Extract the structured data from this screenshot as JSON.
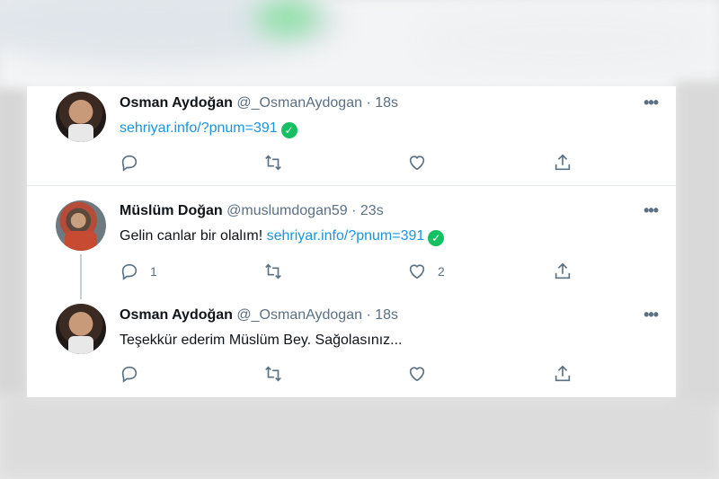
{
  "tweets": [
    {
      "name": "Osman Aydoğan",
      "handle": "@_OsmanAydogan",
      "sep": "·",
      "time": "18s",
      "text": "",
      "link": "sehriyar.info/?pnum=391",
      "verified_link": true,
      "reply_count": "",
      "like_count": ""
    },
    {
      "name": "Müslüm Doğan",
      "handle": "@muslumdogan59",
      "sep": "·",
      "time": "23s",
      "text": "Gelin canlar bir olalım!",
      "link": "sehriyar.info/?pnum=391",
      "verified_link": true,
      "reply_count": "1",
      "like_count": "2"
    },
    {
      "name": "Osman Aydoğan",
      "handle": "@_OsmanAydogan",
      "sep": "·",
      "time": "18s",
      "text": "Teşekkür ederim Müslüm Bey. Sağolasınız...",
      "link": "",
      "verified_link": false,
      "reply_count": "",
      "like_count": ""
    }
  ],
  "icons": {
    "more": "more-horizontal-icon",
    "reply": "reply-icon",
    "retweet": "retweet-icon",
    "like": "heart-icon",
    "share": "share-icon",
    "check": "check-circle-icon"
  },
  "colors": {
    "link": "#1b95e0",
    "check": "#17bf63",
    "muted": "#5b7083",
    "text": "#0f1419"
  },
  "glyphs": {
    "more": "•••",
    "check": "✓"
  }
}
